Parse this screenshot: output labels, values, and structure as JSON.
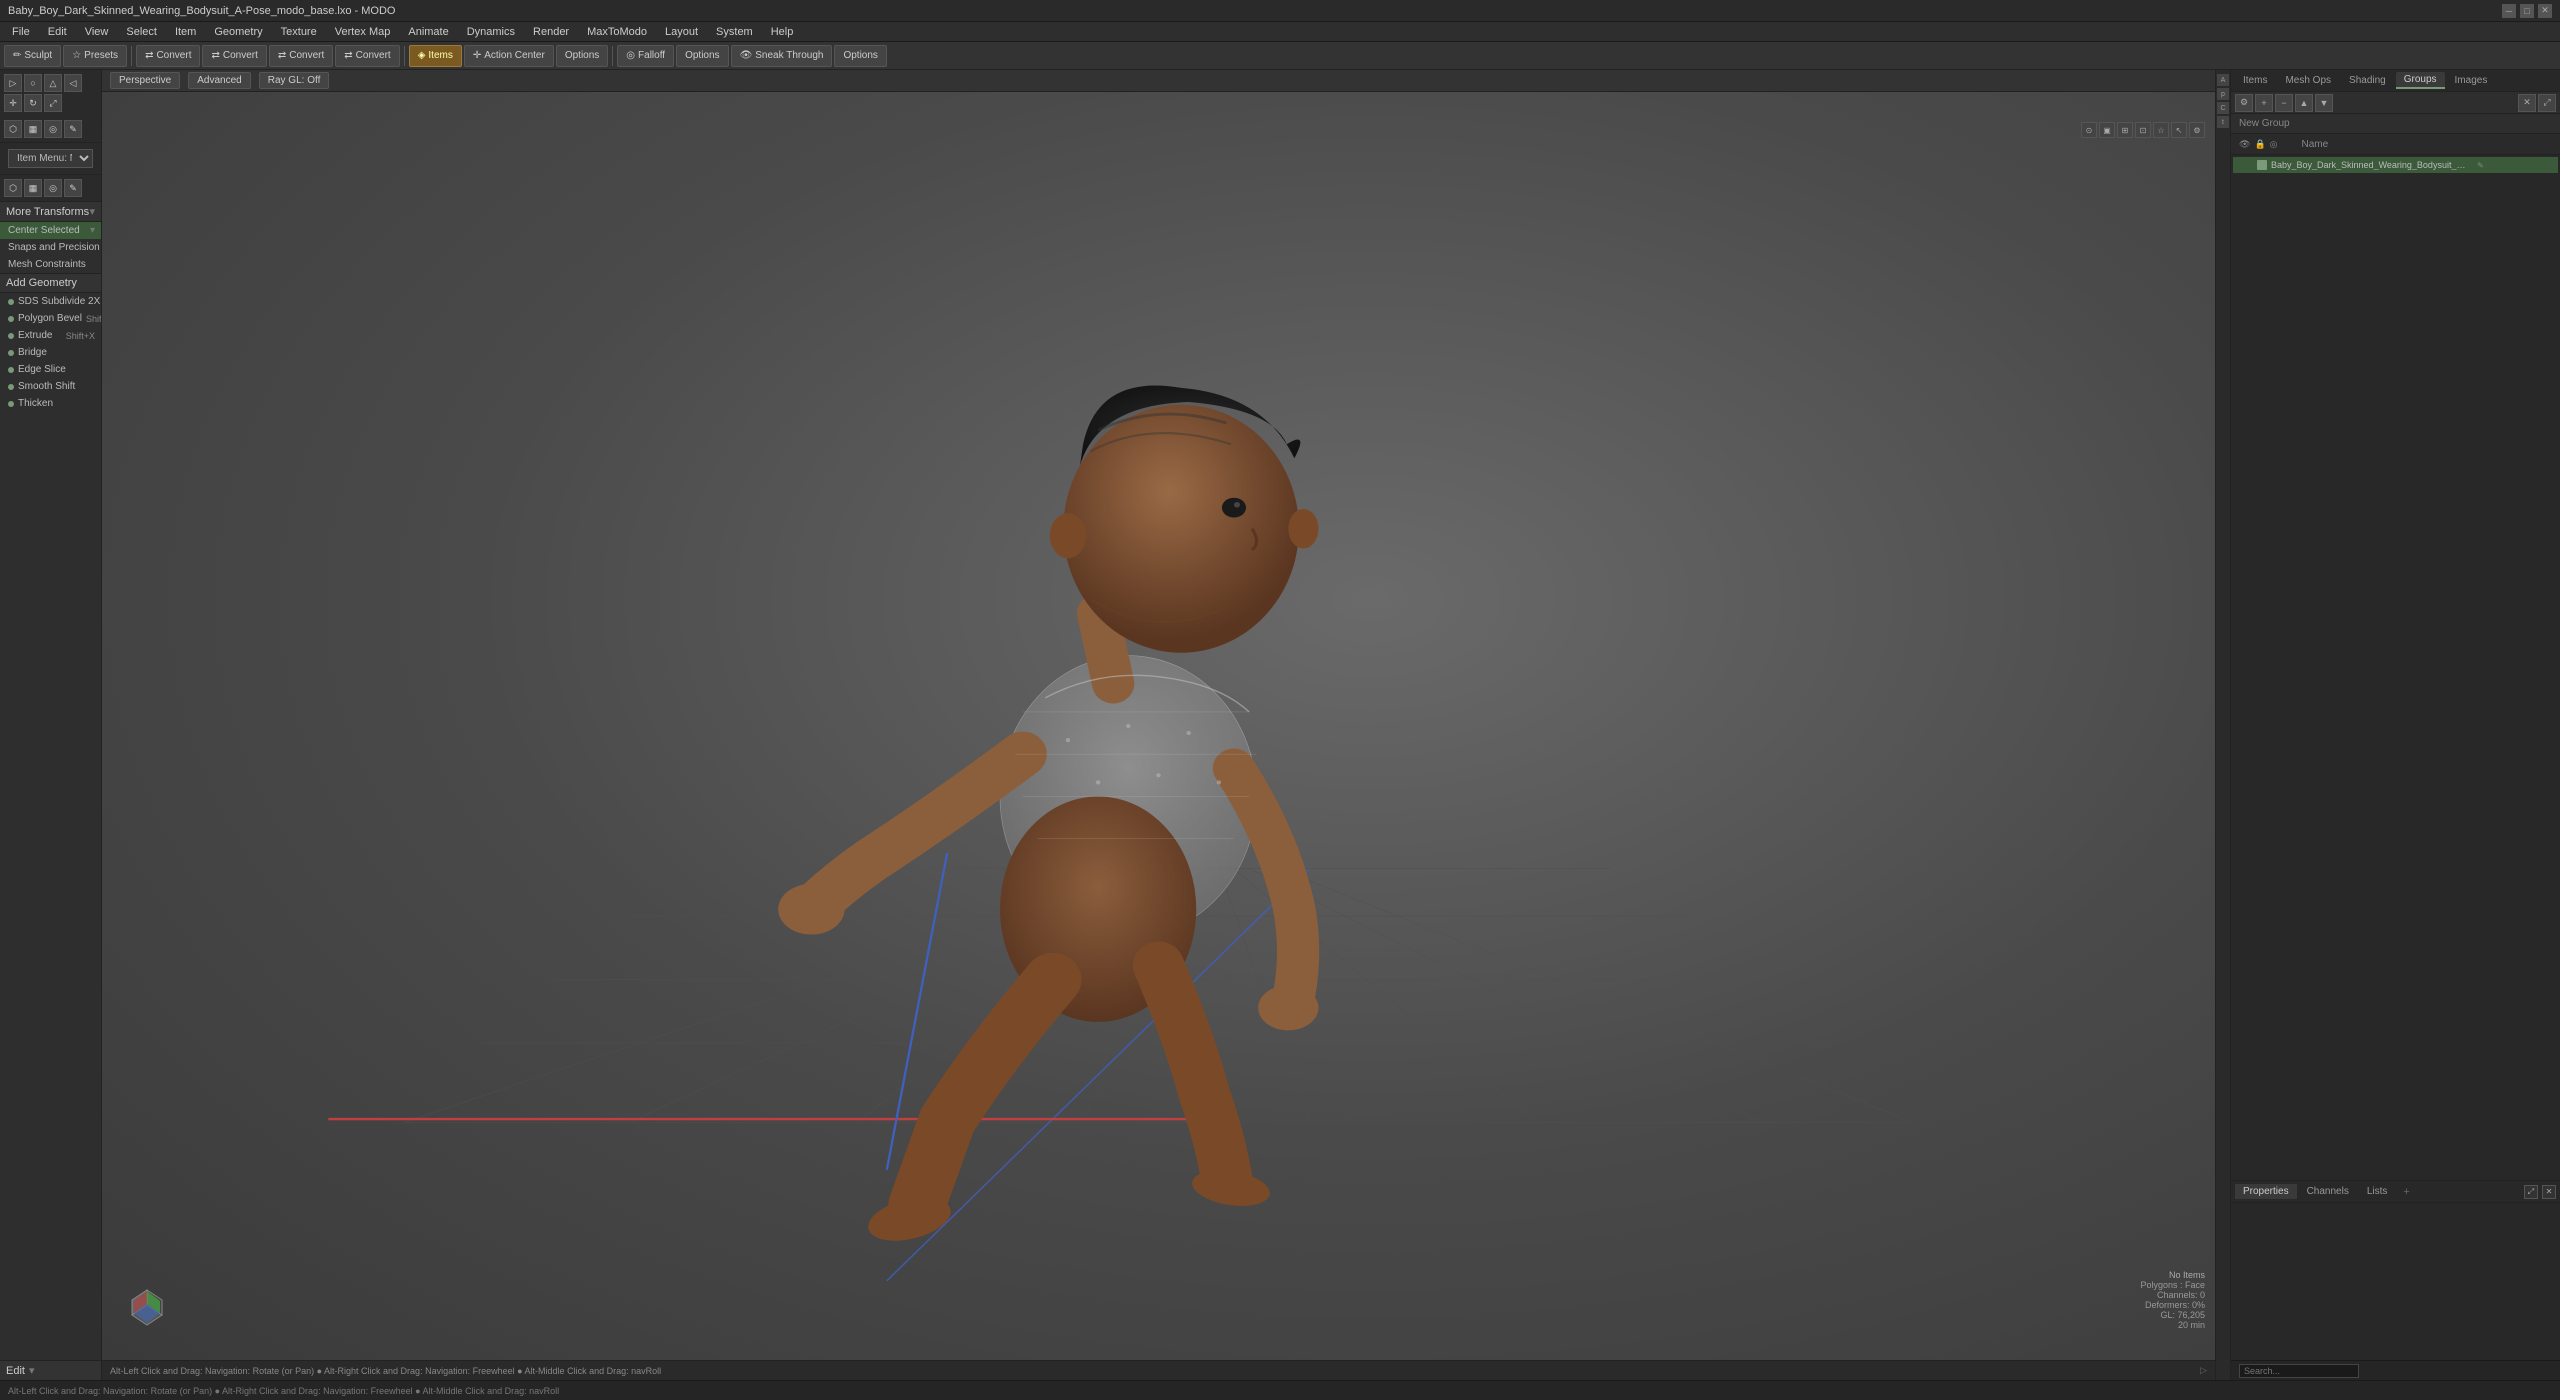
{
  "titlebar": {
    "title": "Baby_Boy_Dark_Skinned_Wearing_Bodysuit_A-Pose_modo_base.lxo - MODO",
    "controls": [
      "─",
      "□",
      "✕"
    ]
  },
  "menubar": {
    "items": [
      "File",
      "Edit",
      "View",
      "Select",
      "Item",
      "Geometry",
      "Texture",
      "Vertex Map",
      "Animate",
      "Dynamics",
      "Render",
      "MaxToModo",
      "Layout",
      "System",
      "Help"
    ]
  },
  "toolbar": {
    "sculpt_label": "Sculpt",
    "presets_label": "Presets",
    "convert_labels": [
      "Convert",
      "Convert",
      "Convert",
      "Convert"
    ],
    "items_label": "Items",
    "action_center_label": "Action Center",
    "options_labels": [
      "Options",
      "Options"
    ],
    "falloff_label": "Falloff",
    "sneak_through_label": "Sneak Through"
  },
  "left_sidebar": {
    "sculpt_presets_label": "Sculpt Presets",
    "center_selected_label": "Center Selected",
    "more_transforms_label": "More Transforms",
    "add_geometry_label": "Add Geometry",
    "edit_label": "Edit",
    "item_menu_label": "Item Menu: New Item",
    "tools": [
      {
        "label": "SDS Subdivide 2X",
        "key": ""
      },
      {
        "label": "Polygon Bevel",
        "key": "Shift+B"
      },
      {
        "label": "Extrude",
        "key": "Shift+X"
      },
      {
        "label": "Bridge",
        "key": ""
      },
      {
        "label": "Edge Slice",
        "key": ""
      },
      {
        "label": "Smooth Shift",
        "key": ""
      },
      {
        "label": "Thicken",
        "key": ""
      }
    ]
  },
  "viewport": {
    "perspective_label": "Perspective",
    "advanced_label": "Advanced",
    "ray_gl_label": "Ray GL: Off",
    "status_text": "Alt-Left Click and Drag: Navigation: Rotate (or Pan) ● Alt-Right Click and Drag: Navigation: Freewheel ● Alt-Middle Click and Drag: navRoll",
    "info": {
      "no_items": "No Items",
      "polygons_face": "Polygons : Face",
      "channels": "Channels: 0",
      "deformers": "Deformers: 0%",
      "coords": "GL: 76,205",
      "fps": "20 min"
    }
  },
  "right_panel": {
    "tabs": [
      "Items",
      "Mesh Ops",
      "Shading",
      "Groups",
      "Images"
    ],
    "active_tab": "Groups",
    "new_group_label": "New Group",
    "columns": {
      "name_label": "Name"
    },
    "scene_items": [
      {
        "label": "Baby_Boy_Dark_Skinned_Wearing_Bodysuit_A_Pose",
        "selected": true
      }
    ],
    "bottom_tabs": [
      "Properties",
      "Channels",
      "Lists"
    ],
    "active_bottom_tab": "Properties"
  },
  "icons": {
    "sculpt": "✏",
    "presets": "☆",
    "convert": "⇄",
    "items": "◈",
    "settings": "⚙",
    "move": "✛",
    "rotate": "↻",
    "scale": "⤢",
    "eye": "👁",
    "lock": "🔒",
    "dots": "…",
    "chevron": "▾",
    "plus": "+",
    "minus": "−",
    "x": "✕",
    "folder": "📁",
    "mesh": "▦",
    "check": "✓",
    "dot": "●",
    "camera": "📷",
    "light": "💡"
  },
  "colors": {
    "accent_green": "#7a9a7a",
    "bg_dark": "#2a2a2a",
    "bg_medium": "#2e2e2e",
    "bg_light": "#383838",
    "orange": "#c87820",
    "red_axis": "#c04040",
    "blue_axis": "#4060c0",
    "grid": "#505050"
  }
}
